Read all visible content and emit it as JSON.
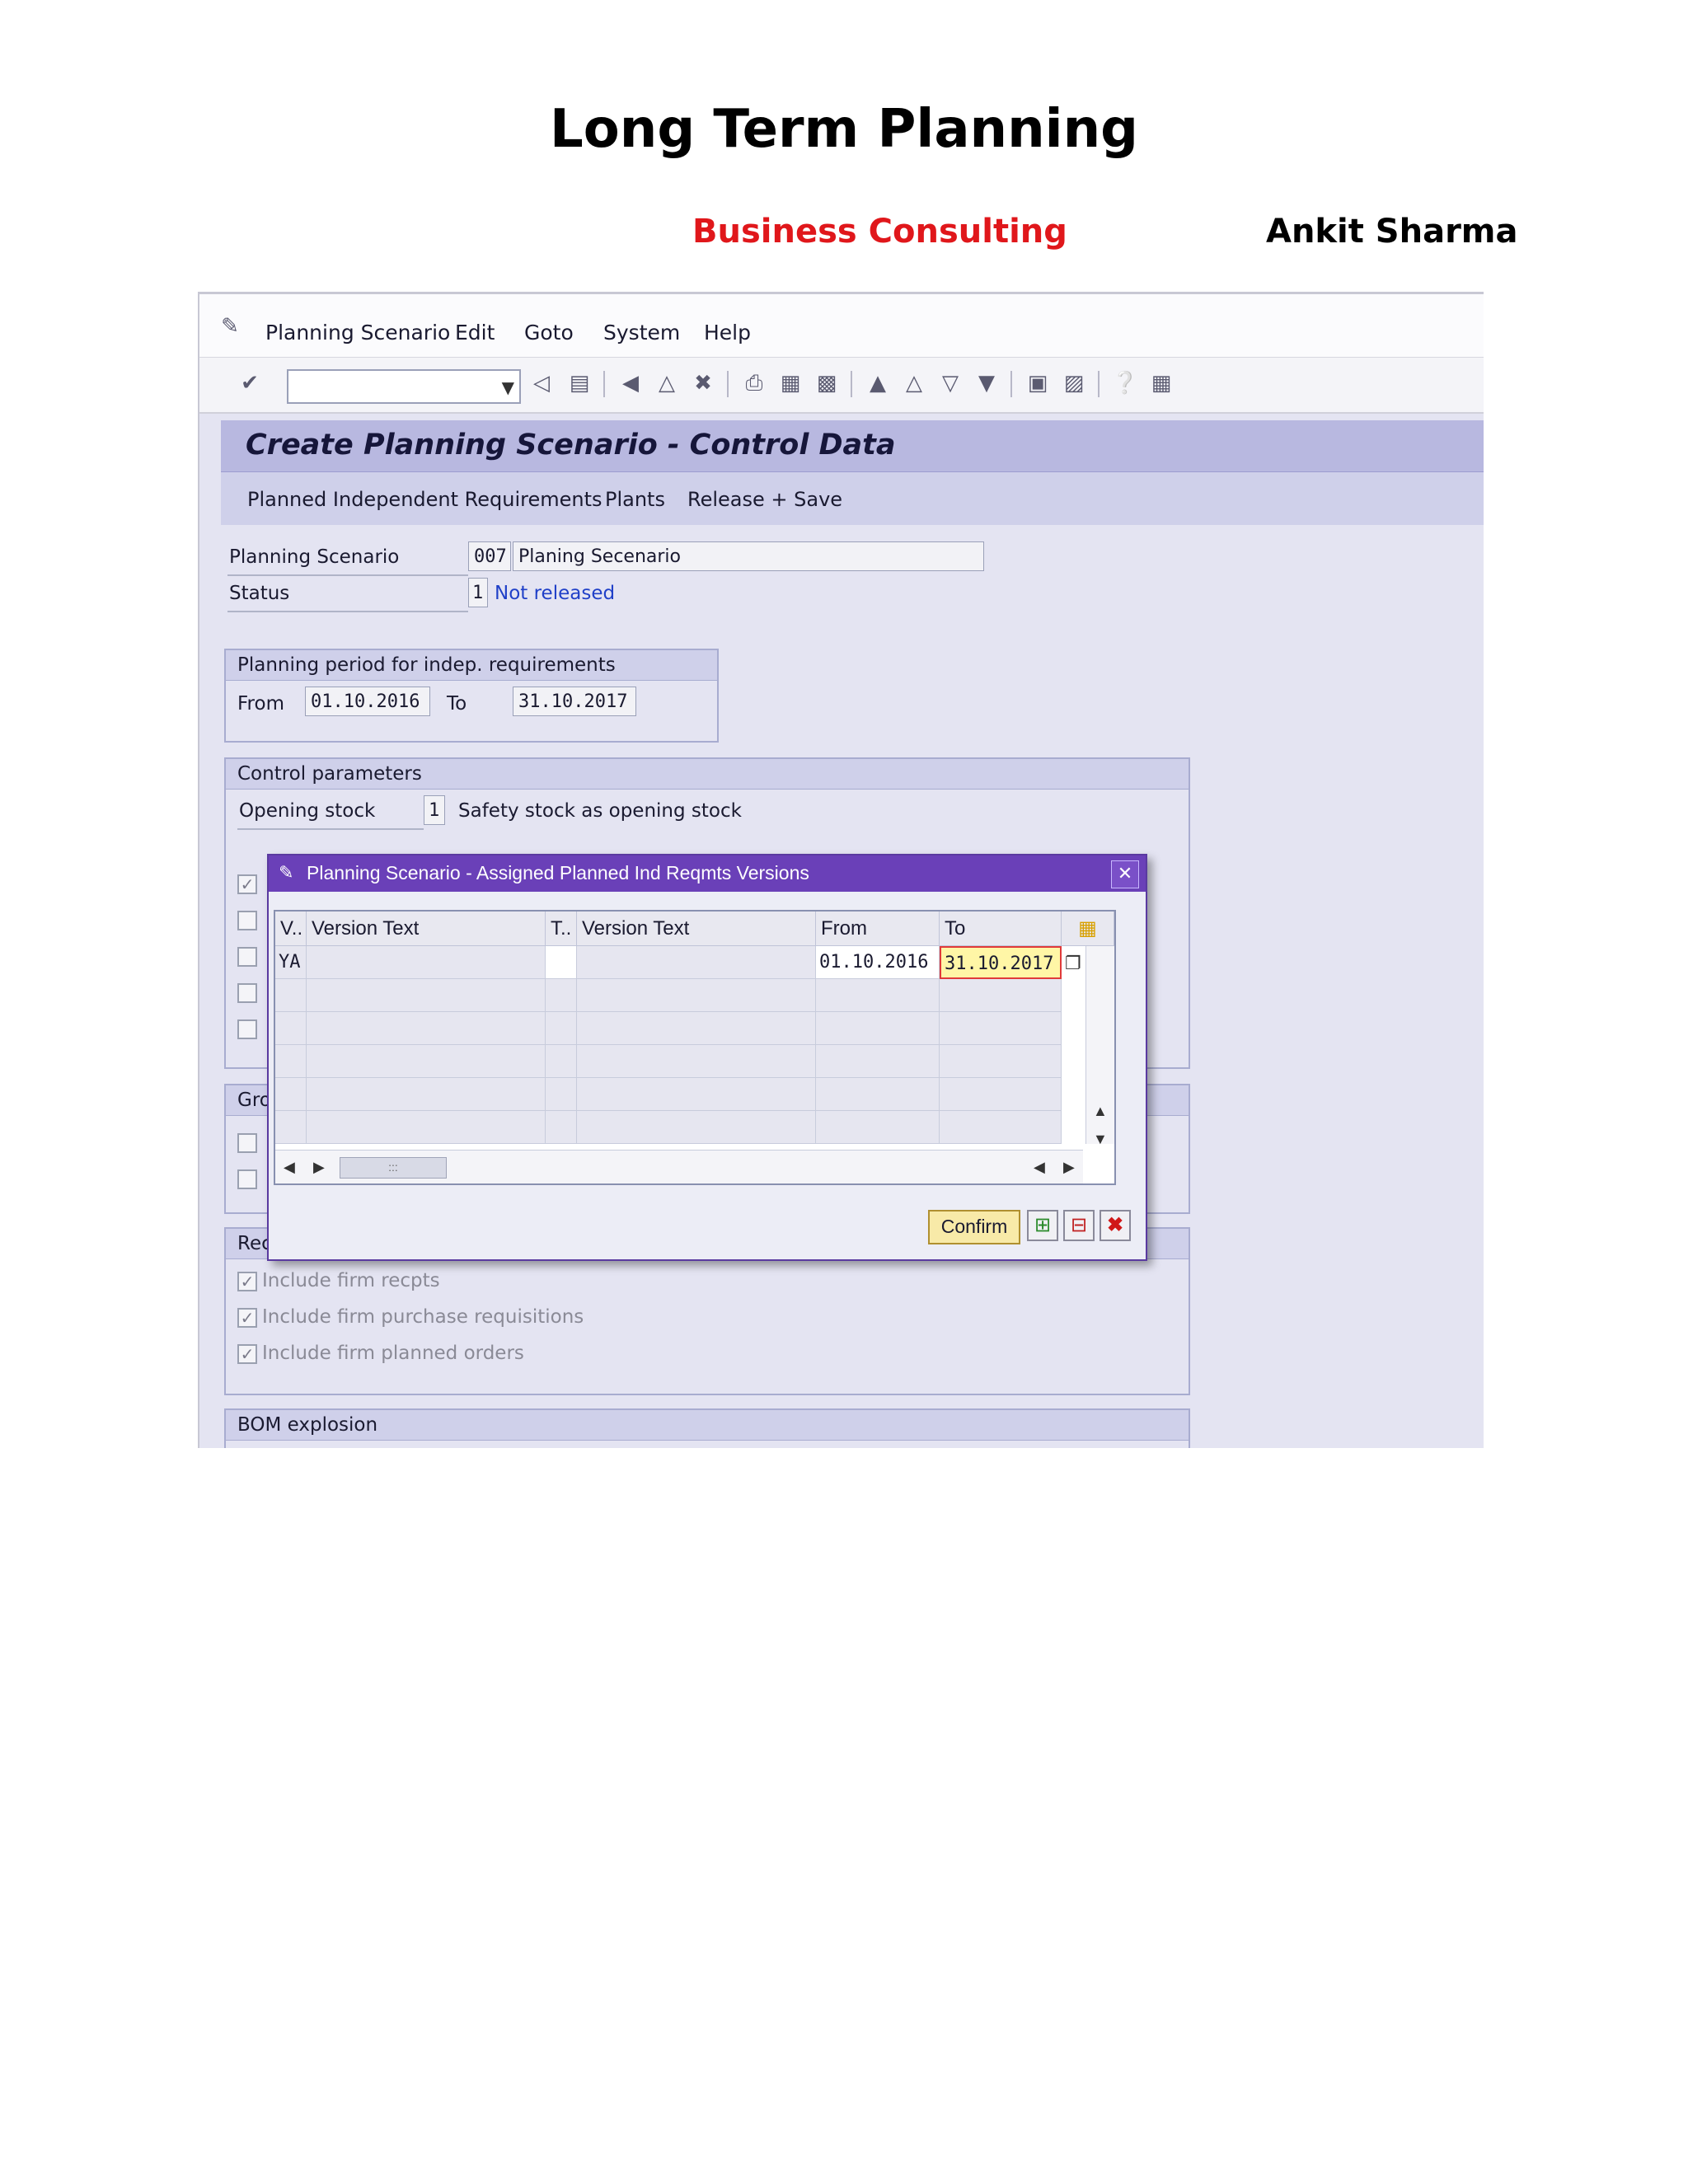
{
  "document": {
    "title": "Long Term Planning",
    "subtitle_left": "Business Consulting",
    "subtitle_right": "Ankit Sharma",
    "colors": {
      "accent_red": "#e0171b"
    }
  },
  "menubar": [
    "Planning Scenario",
    "Edit",
    "Goto",
    "System",
    "Help"
  ],
  "screen": {
    "title": "Create Planning Scenario - Control Data",
    "app_buttons": [
      "Planned Independent Requirements",
      "Plants",
      "Release + Save"
    ]
  },
  "header_fields": {
    "planning_scenario_label": "Planning Scenario",
    "planning_scenario_value": "007",
    "planning_scenario_text": "Planing Secenario",
    "status_label": "Status",
    "status_value": "1",
    "status_text": "Not released"
  },
  "period_group": {
    "title": "Planning period for indep. requirements",
    "from_label": "From",
    "from_value": "01.10.2016",
    "to_label": "To",
    "to_value": "31.10.2017"
  },
  "control_group": {
    "title": "Control parameters",
    "opening_stock_label": "Opening stock",
    "opening_stock_value": "1",
    "opening_stock_text": "Safety stock as opening stock"
  },
  "group2_title": "Gro",
  "group3_title": "Rec",
  "recpt_options": [
    "Include firm recpts",
    "Include firm purchase requisitions",
    "Include firm planned orders"
  ],
  "bom_title": "BOM explosion",
  "popup": {
    "title": "Planning Scenario - Assigned Planned Ind Reqmts Versions",
    "columns": [
      "V..",
      "Version Text",
      "T..",
      "Version Text",
      "From",
      "To"
    ],
    "row": {
      "v": "YA",
      "from": "01.10.2016",
      "to": "31.10.2017"
    },
    "confirm_label": "Confirm",
    "scroll_thumb": ":::"
  }
}
